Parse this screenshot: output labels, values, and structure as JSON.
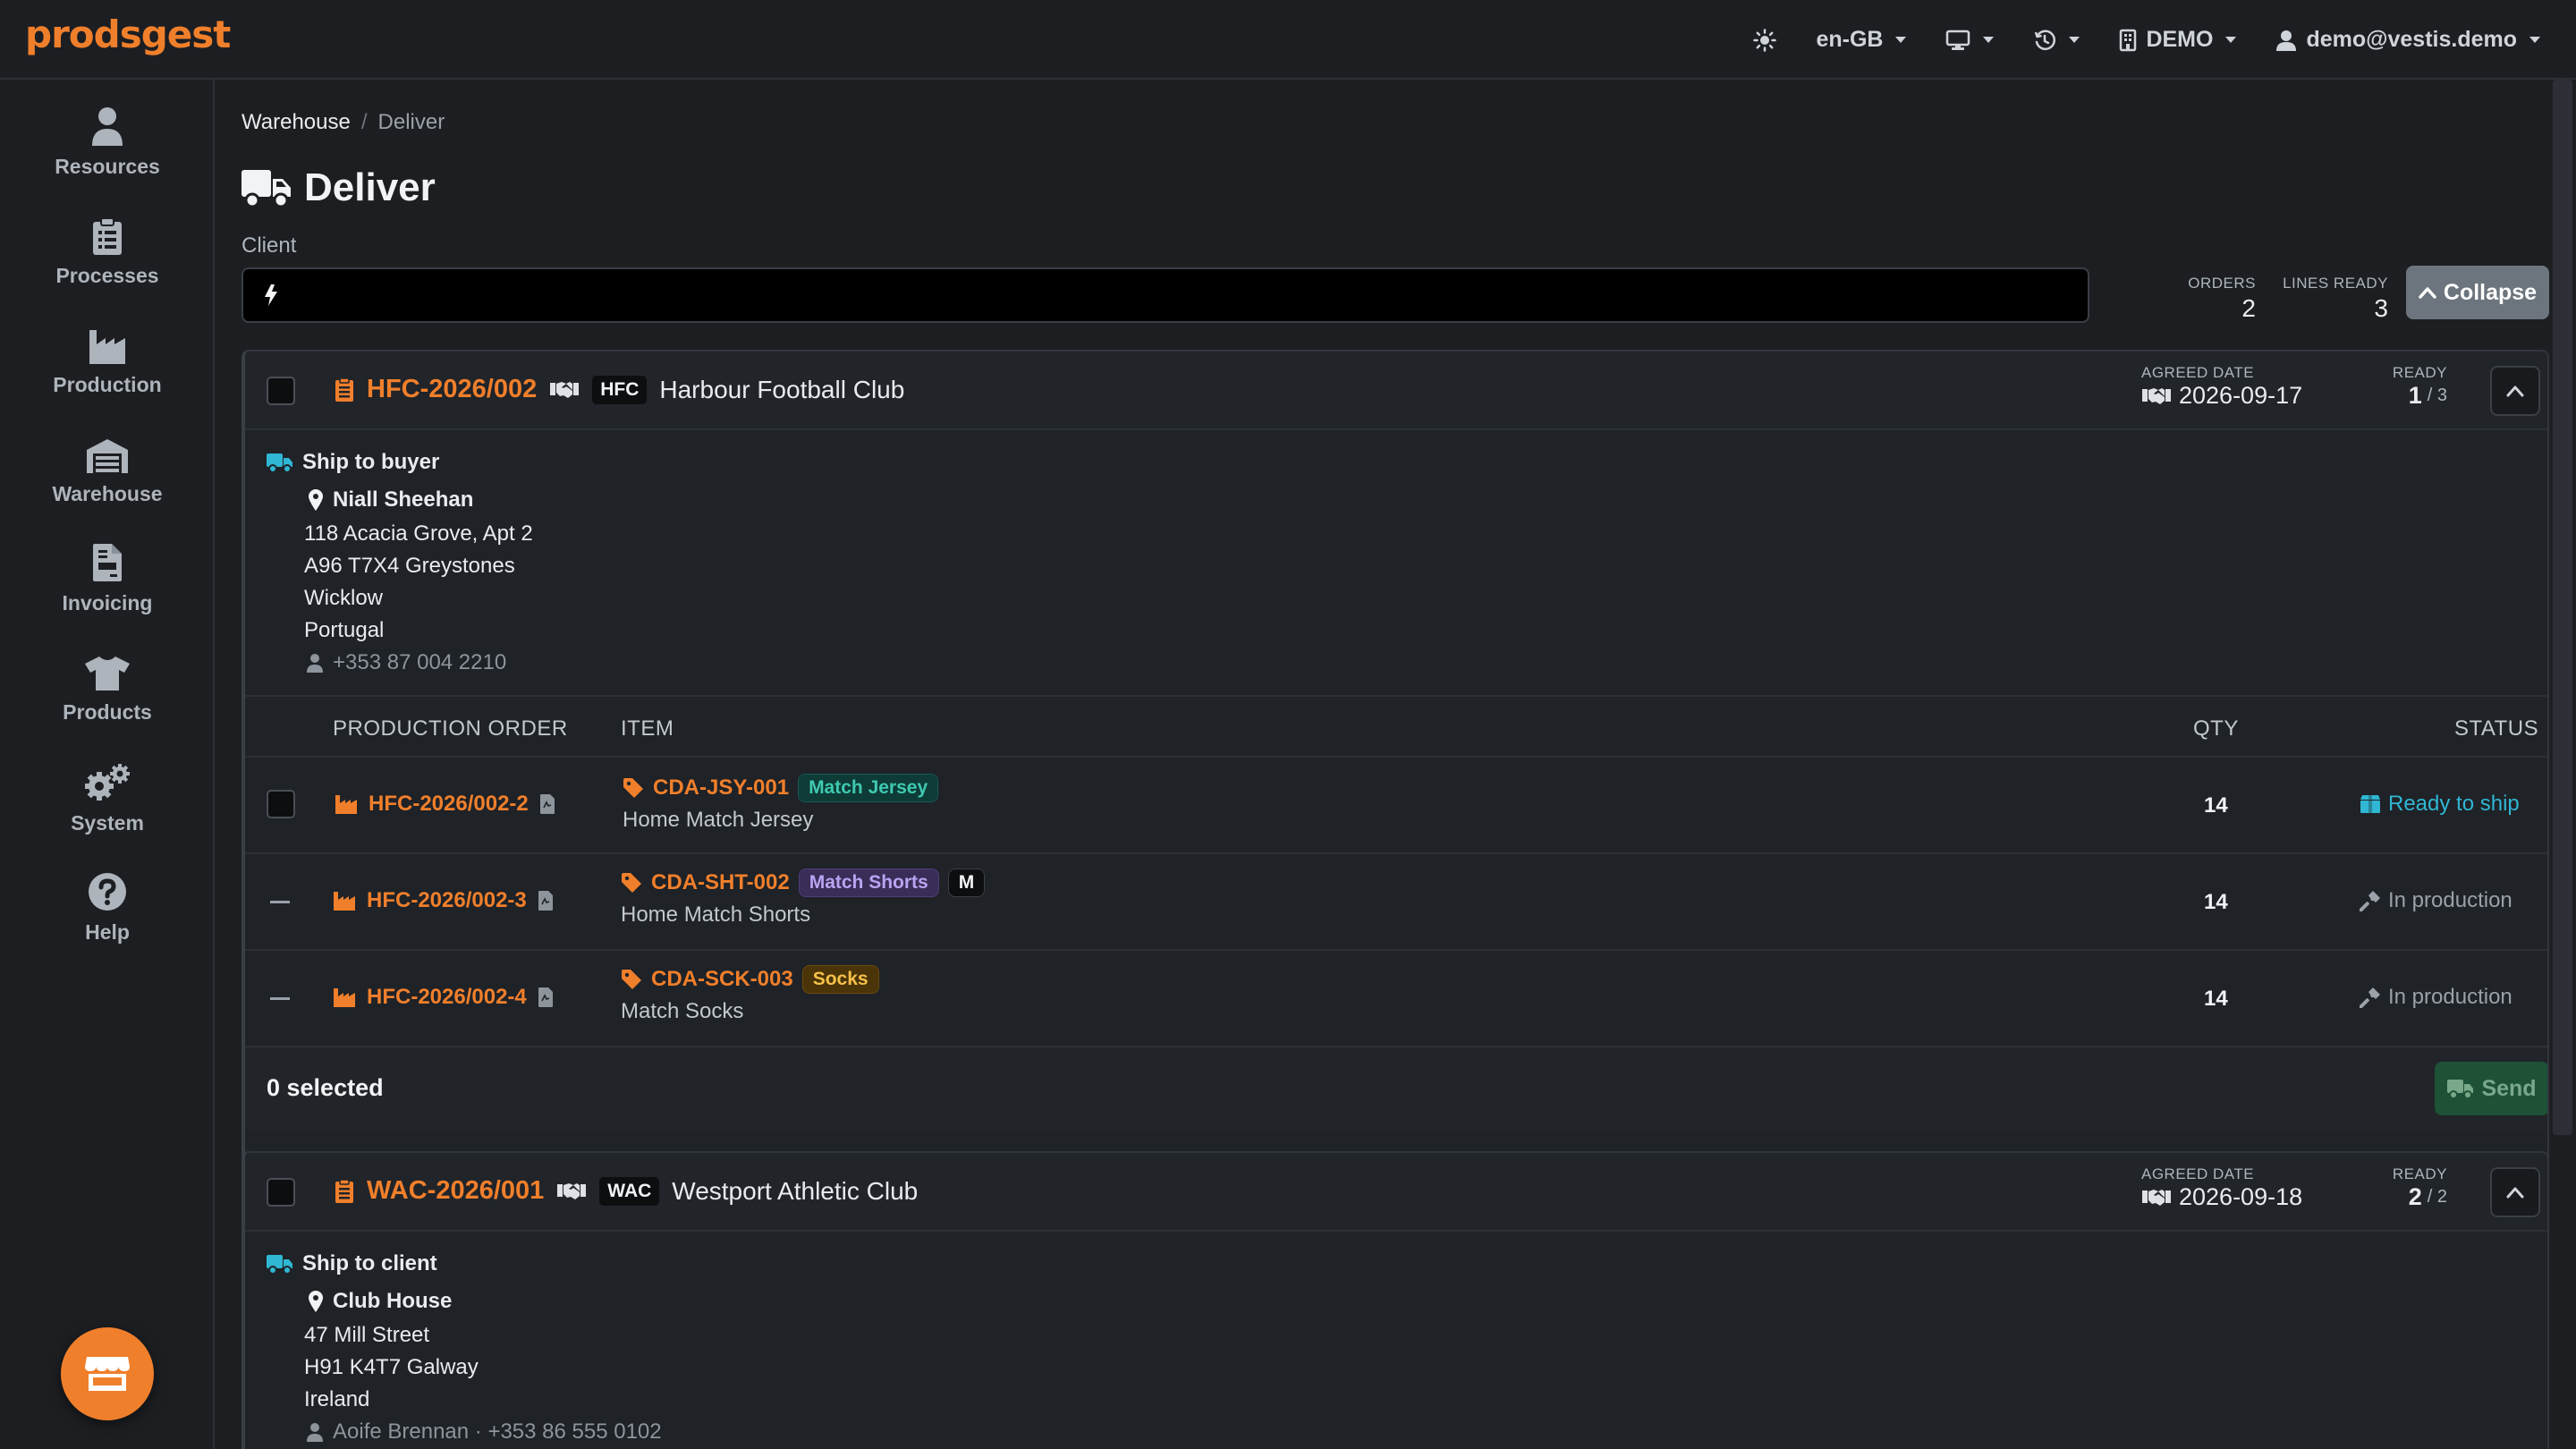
{
  "app": {
    "brand": "prodsgest"
  },
  "topnav": {
    "locale": "en-GB",
    "demo_label": "DEMO",
    "user": "demo@vestis.demo"
  },
  "sidebar": {
    "items": [
      {
        "label": "Resources",
        "icon": "person-icon"
      },
      {
        "label": "Processes",
        "icon": "clipboard-icon"
      },
      {
        "label": "Production",
        "icon": "factory-icon"
      },
      {
        "label": "Warehouse",
        "icon": "warehouse-icon"
      },
      {
        "label": "Invoicing",
        "icon": "invoice-icon"
      },
      {
        "label": "Products",
        "icon": "shirt-icon"
      },
      {
        "label": "System",
        "icon": "gears-icon"
      },
      {
        "label": "Help",
        "icon": "help-icon"
      }
    ]
  },
  "breadcrumb": {
    "parent": "Warehouse",
    "separator": "/",
    "current": "Deliver"
  },
  "page": {
    "title": "Deliver"
  },
  "client_filter": {
    "label": "Client",
    "value": ""
  },
  "stats": {
    "orders_label": "ORDERS",
    "orders_value": "2",
    "lines_label": "LINES READY",
    "lines_value": "3"
  },
  "collapse_label": "Collapse",
  "colors": {
    "accent": "#f07f2b",
    "ready": "#2fb7d3",
    "send": "#1e5236"
  },
  "orders": [
    {
      "number": "HFC-2026/002",
      "code": "HFC",
      "client": "Harbour Football Club",
      "agreed_label": "AGREED DATE",
      "agreed_date": "2026-09-17",
      "ready_label": "READY",
      "ready_count": "1",
      "ready_total": "/ 3",
      "ship_title": "Ship to buyer",
      "contact_name": "Niall Sheehan",
      "address": [
        "118 Acacia Grove, Apt 2",
        "A96 T7X4 Greystones",
        "Wicklow",
        "Portugal"
      ],
      "phone": "+353 87 004 2210",
      "table": {
        "col_po": "PRODUCTION ORDER",
        "col_item": "ITEM",
        "col_qty": "QTY",
        "col_status": "STATUS"
      },
      "lines": [
        {
          "po": "HFC-2026/002-2",
          "sku": "CDA-JSY-001",
          "tag": "Match Jersey",
          "size": "",
          "desc": "Home Match Jersey",
          "qty": "14",
          "status": "Ready to ship"
        },
        {
          "po": "HFC-2026/002-3",
          "sku": "CDA-SHT-002",
          "tag": "Match Shorts",
          "size": "M",
          "desc": "Home Match Shorts",
          "qty": "14",
          "status": "In production"
        },
        {
          "po": "HFC-2026/002-4",
          "sku": "CDA-SCK-003",
          "tag": "Socks",
          "size": "",
          "desc": "Match Socks",
          "qty": "14",
          "status": "In production"
        }
      ],
      "selected_text": "0 selected",
      "send_label": "Send"
    },
    {
      "number": "WAC-2026/001",
      "code": "WAC",
      "client": "Westport Athletic Club",
      "agreed_label": "AGREED DATE",
      "agreed_date": "2026-09-18",
      "ready_label": "READY",
      "ready_count": "2",
      "ready_total": "/ 2",
      "ship_title": "Ship to client",
      "contact_name": "Club House",
      "address": [
        "47 Mill Street",
        "H91 K4T7 Galway",
        "Ireland"
      ],
      "contact_line": "Aoife Brennan · +353 86 555 0102"
    }
  ]
}
